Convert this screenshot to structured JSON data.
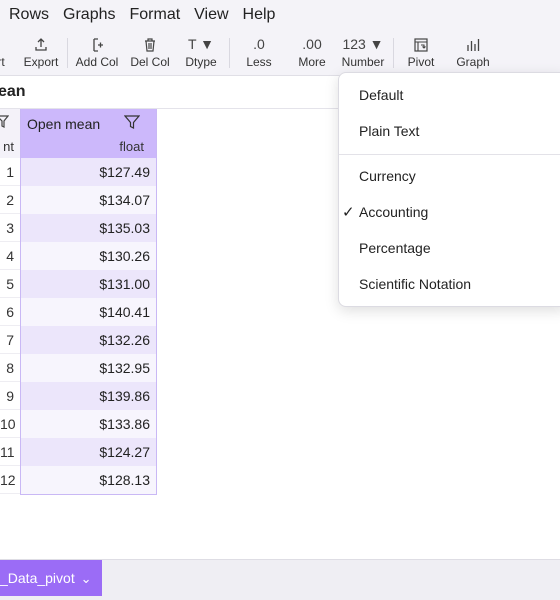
{
  "menubar": {
    "items": [
      "Rows",
      "Graphs",
      "Format",
      "View",
      "Help"
    ]
  },
  "toolbar": {
    "buttons": [
      {
        "label": "rt",
        "icon": ""
      },
      {
        "label": "Export",
        "icon": "export-icon"
      },
      {
        "label": "Add Col",
        "icon": "add-column-icon"
      },
      {
        "label": "Del Col",
        "icon": "trash-icon"
      },
      {
        "label": "Dtype",
        "icon": "T ▼"
      },
      {
        "label": "Less",
        "icon": ".0"
      },
      {
        "label": "More",
        "icon": ".00"
      },
      {
        "label": "Number",
        "icon": "123 ▼"
      },
      {
        "label": "Pivot",
        "icon": "pivot-icon"
      },
      {
        "label": "Graph",
        "icon": "graph-icon"
      }
    ]
  },
  "title": "ean",
  "table": {
    "index_header_top": "",
    "index_header_bottom": "nt",
    "column": {
      "name": "Open mean",
      "dtype": "float"
    },
    "rows": [
      {
        "index": "1",
        "value": "$127.49"
      },
      {
        "index": "2",
        "value": "$134.07"
      },
      {
        "index": "3",
        "value": "$135.03"
      },
      {
        "index": "4",
        "value": "$130.26"
      },
      {
        "index": "5",
        "value": "$131.00"
      },
      {
        "index": "6",
        "value": "$140.41"
      },
      {
        "index": "7",
        "value": "$132.26"
      },
      {
        "index": "8",
        "value": "$132.95"
      },
      {
        "index": "9",
        "value": "$139.86"
      },
      {
        "index": "10",
        "value": "$133.86"
      },
      {
        "index": "11",
        "value": "$124.27"
      },
      {
        "index": "12",
        "value": "$128.13"
      }
    ]
  },
  "format_menu": {
    "items": [
      "Default",
      "Plain Text",
      "Currency",
      "Accounting",
      "Percentage",
      "Scientific Notation"
    ],
    "selected": "Accounting",
    "check": "✓"
  },
  "sheet_tab": {
    "label": "_Data_pivot",
    "chevron": "⌄"
  },
  "colors": {
    "accent": "#9b6cf6",
    "header": "#ccb8fb",
    "row_alt": "#ece6fb"
  }
}
